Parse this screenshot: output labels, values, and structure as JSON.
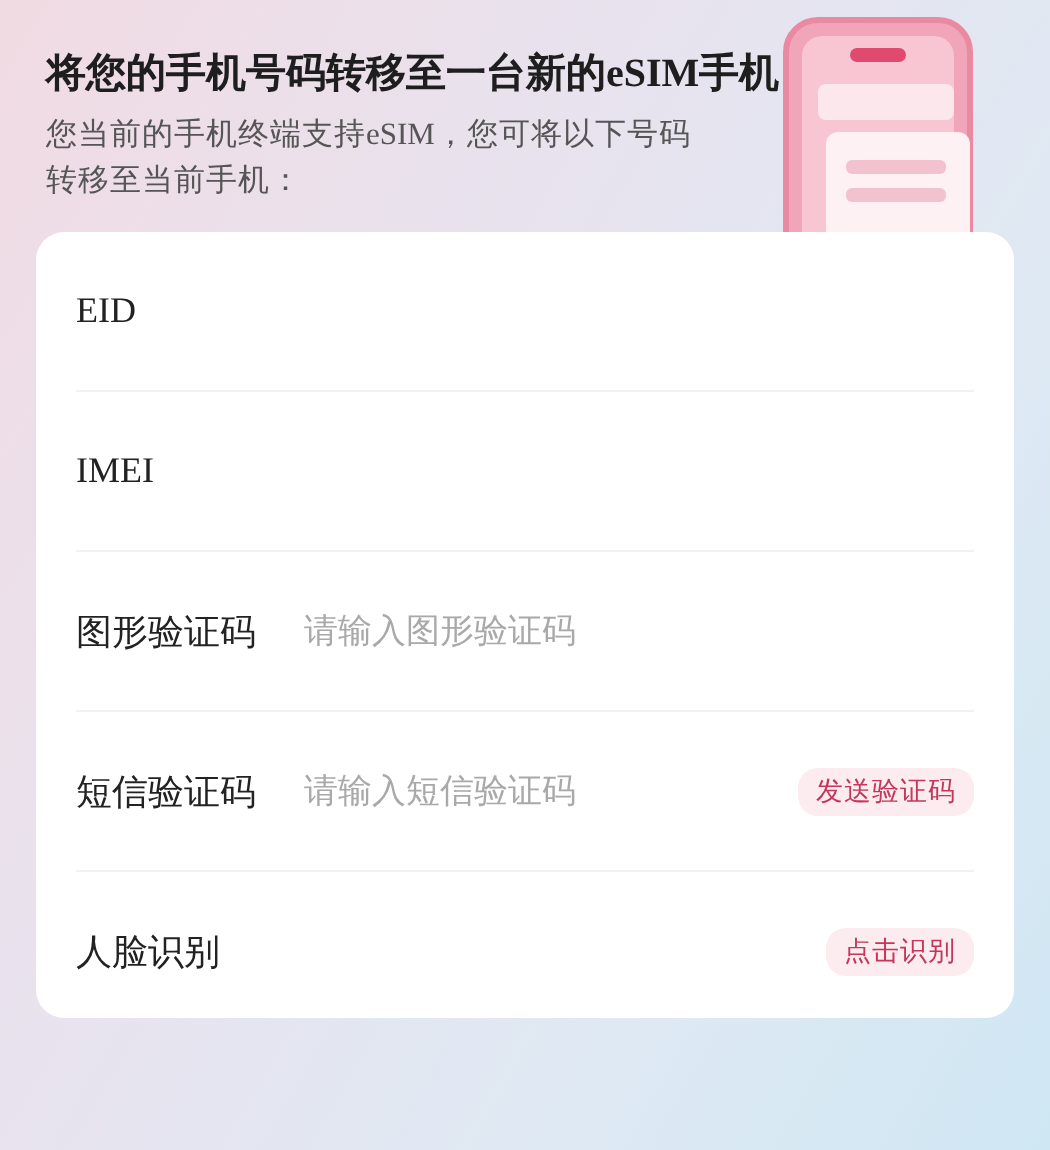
{
  "title": "将您的手机号码转移至一台新的eSIM手机",
  "subtitle": "您当前的手机终端支持eSIM，您可将以下号码转移至当前手机：",
  "rows": [
    {
      "kind": "label",
      "label": "EID"
    },
    {
      "kind": "label",
      "label": "IMEI"
    },
    {
      "kind": "input",
      "label": "图形验证码",
      "placeholder": "请输入图形验证码"
    },
    {
      "kind": "input",
      "label": "短信验证码",
      "placeholder": "请输入短信验证码",
      "action": "发送验证码"
    },
    {
      "kind": "button",
      "label": "人脸识别",
      "action": "点击识别"
    }
  ]
}
